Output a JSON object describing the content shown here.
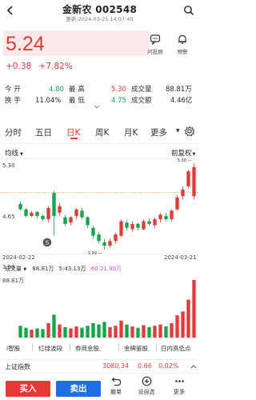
{
  "header": {
    "title": "金新农 002548",
    "updated": "更新:2024-03-21 14:07:45"
  },
  "quote": {
    "price": "5.24",
    "change": "+0.38",
    "change_pct": "+7.82%",
    "buttons": [
      {
        "label": "问投顾",
        "icon": "chat-icon"
      },
      {
        "label": "预警",
        "icon": "bell-icon"
      }
    ]
  },
  "stats": {
    "row1": {
      "open_label": "今 开",
      "open": "4.80",
      "high_label": "最 高",
      "high": "5.30",
      "volume_label": "成交量",
      "volume": "88.81万"
    },
    "row2": {
      "turnover_label": "换 手",
      "turnover": "11.04%",
      "low_label": "最 低",
      "low": "4.75",
      "amount_label": "成交额",
      "amount": "4.46亿"
    }
  },
  "tabs": [
    {
      "label": "分时",
      "active": false
    },
    {
      "label": "五日",
      "active": false
    },
    {
      "label": "日K",
      "active": true
    },
    {
      "label": "周K",
      "active": false
    },
    {
      "label": "月K",
      "active": false
    },
    {
      "label": "更多",
      "active": false
    }
  ],
  "chart_controls": {
    "ma_label": "均线",
    "adjust_label": "前复权"
  },
  "colors": {
    "up": "#e23b3b",
    "down": "#17a34a",
    "accent": "#e23b3b",
    "buy": "#e53935",
    "sell": "#1e6fe6"
  },
  "chart_data": {
    "type": "candlestick",
    "y_ticks": [
      "5.30",
      "4.65",
      "3.99"
    ],
    "ylim": [
      3.99,
      5.3
    ],
    "x_labels": [
      "2024-02-22",
      "2024-03-21"
    ],
    "prev_close_line": 4.86,
    "high_marker": "5.30",
    "low_marker": "3.99",
    "candles": [
      {
        "o": 4.68,
        "c": 4.6,
        "h": 4.72,
        "l": 4.58
      },
      {
        "o": 4.6,
        "c": 4.5,
        "h": 4.62,
        "l": 4.48
      },
      {
        "o": 4.5,
        "c": 4.55,
        "h": 4.58,
        "l": 4.48
      },
      {
        "o": 4.56,
        "c": 4.5,
        "h": 4.58,
        "l": 4.46
      },
      {
        "o": 4.5,
        "c": 4.45,
        "h": 4.53,
        "l": 4.42
      },
      {
        "o": 4.45,
        "c": 4.62,
        "h": 4.65,
        "l": 4.4
      },
      {
        "o": 4.85,
        "c": 4.5,
        "h": 4.88,
        "l": 4.2
      },
      {
        "o": 4.55,
        "c": 4.65,
        "h": 4.7,
        "l": 4.5
      },
      {
        "o": 4.48,
        "c": 4.38,
        "h": 4.52,
        "l": 4.35
      },
      {
        "o": 4.4,
        "c": 4.48,
        "h": 4.5,
        "l": 4.36
      },
      {
        "o": 4.5,
        "c": 4.6,
        "h": 4.62,
        "l": 4.45
      },
      {
        "o": 4.58,
        "c": 4.48,
        "h": 4.62,
        "l": 4.45
      },
      {
        "o": 4.48,
        "c": 4.36,
        "h": 4.5,
        "l": 4.32
      },
      {
        "o": 4.32,
        "c": 4.2,
        "h": 4.36,
        "l": 4.15
      },
      {
        "o": 4.22,
        "c": 4.12,
        "h": 4.26,
        "l": 4.08
      },
      {
        "o": 4.1,
        "c": 4.05,
        "h": 4.15,
        "l": 3.99
      },
      {
        "o": 4.05,
        "c": 4.12,
        "h": 4.16,
        "l": 4.02
      },
      {
        "o": 4.12,
        "c": 4.22,
        "h": 4.25,
        "l": 4.08
      },
      {
        "o": 4.2,
        "c": 4.42,
        "h": 4.45,
        "l": 4.18
      },
      {
        "o": 4.4,
        "c": 4.32,
        "h": 4.44,
        "l": 4.28
      },
      {
        "o": 4.3,
        "c": 4.38,
        "h": 4.42,
        "l": 4.26
      },
      {
        "o": 4.38,
        "c": 4.32,
        "h": 4.4,
        "l": 4.28
      },
      {
        "o": 4.3,
        "c": 4.42,
        "h": 4.45,
        "l": 4.28
      },
      {
        "o": 4.42,
        "c": 4.38,
        "h": 4.46,
        "l": 4.35
      },
      {
        "o": 4.36,
        "c": 4.45,
        "h": 4.48,
        "l": 4.32
      },
      {
        "o": 4.45,
        "c": 4.52,
        "h": 4.55,
        "l": 4.4
      },
      {
        "o": 4.5,
        "c": 4.45,
        "h": 4.55,
        "l": 4.42
      },
      {
        "o": 4.45,
        "c": 4.58,
        "h": 4.6,
        "l": 4.42
      },
      {
        "o": 4.6,
        "c": 4.78,
        "h": 4.82,
        "l": 4.58
      },
      {
        "o": 4.8,
        "c": 4.9,
        "h": 4.95,
        "l": 4.75
      },
      {
        "o": 4.95,
        "c": 5.18,
        "h": 5.2,
        "l": 4.92
      },
      {
        "o": 4.8,
        "c": 5.24,
        "h": 5.3,
        "l": 4.75
      }
    ],
    "volume": {
      "label": "成交量",
      "value": "88.81万",
      "ma5": "5:43.13万",
      "ma10": "60:21.80万",
      "y_tick": "88.81万",
      "bars": [
        18,
        15,
        12,
        14,
        13,
        22,
        35,
        20,
        16,
        14,
        17,
        15,
        18,
        22,
        20,
        24,
        16,
        18,
        26,
        20,
        17,
        15,
        19,
        16,
        18,
        20,
        17,
        22,
        34,
        40,
        58,
        88
      ]
    }
  },
  "indicators": [
    "i智股",
    "红绿波段",
    "券商金股",
    "金牌鉴股",
    "日内高低点"
  ],
  "index_bar": {
    "name": "上证指数",
    "value": "3080.34",
    "change": "0.66",
    "change_pct": "0.02%"
  },
  "bottom_bar": {
    "buy_label": "买入",
    "sell_label": "卖出",
    "buttons": [
      {
        "label": "撤单",
        "icon": "undo-icon"
      },
      {
        "label": "设自选",
        "icon": "add-watchlist-icon"
      },
      {
        "label": "更多",
        "icon": "more-icon"
      }
    ]
  }
}
